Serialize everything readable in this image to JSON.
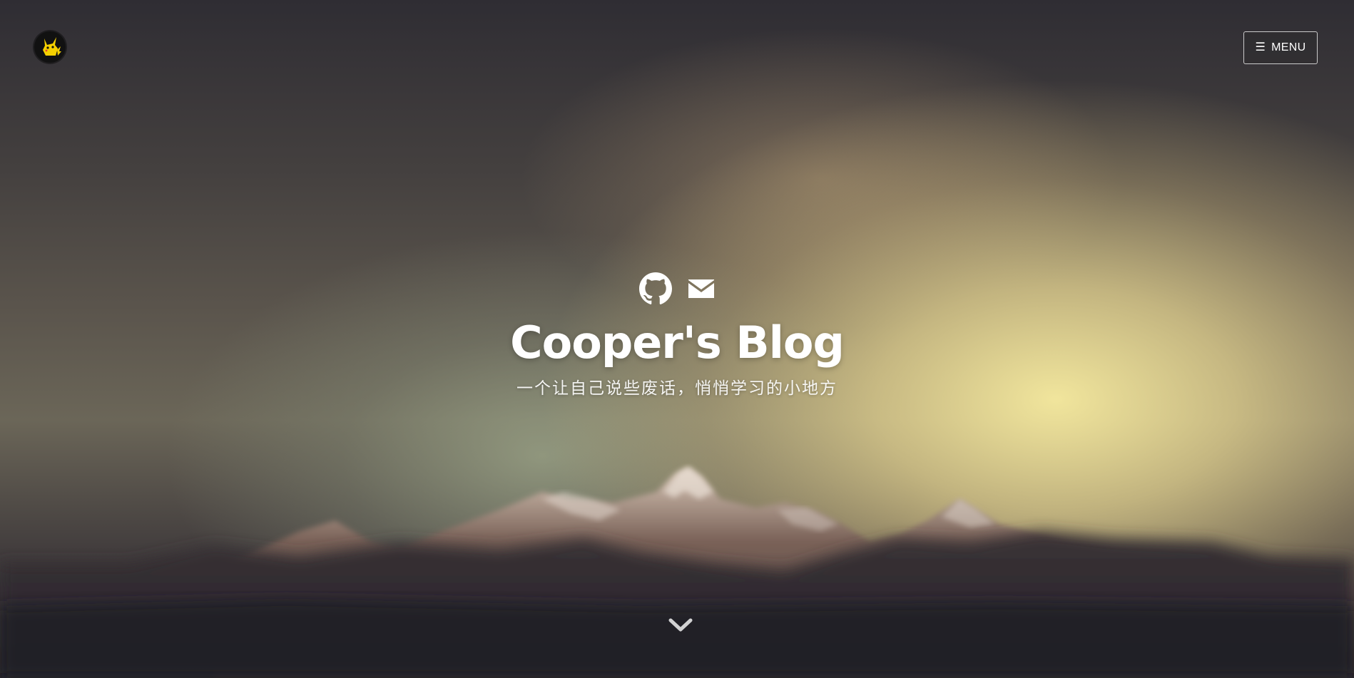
{
  "header": {
    "logo_alt": "pikachu-avatar",
    "menu_label": "MENU",
    "menu_icon": "☰"
  },
  "hero": {
    "title": "Cooper's Blog",
    "subtitle": "一个让自己说些废话，悄悄学习的小地方",
    "social": [
      {
        "icon": "github-icon"
      },
      {
        "icon": "mail-icon"
      }
    ]
  },
  "colors": {
    "text": "#ffffff",
    "logo_bg": "#111111",
    "logo_accent": "#f5d000"
  }
}
